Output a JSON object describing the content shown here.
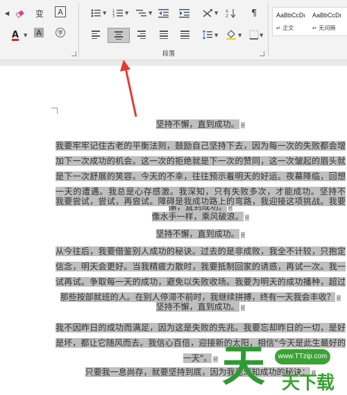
{
  "ribbon": {
    "font_tools": {
      "clear_format_icon": "eraser-icon",
      "phonetic_label": "变",
      "char_border_label": "A",
      "font_color_label": "A",
      "font_color": "#e02020",
      "char_shading_label": "A",
      "enclose_char_label": "字"
    },
    "paragraph": {
      "group_label": "段落"
    },
    "styles": [
      {
        "sample": "AaBbCcDı",
        "name": "↵ 正文"
      },
      {
        "sample": "AaBbCcDı",
        "name": "↵ 无间隔"
      }
    ]
  },
  "document": {
    "highlight_color": "#bfbfbf",
    "paragraphs": [
      "坚持不懈，直到成功。",
      "我要牢牢记住古老的平衡法则，鼓励自己坚持下去，因为每一次的失败都会增加下一次成功的机会。这一次的拒绝就是下一次的赞同，这一次皱起的眉头就是下一次舒展的笑容。今天的不幸，往往预示着明天的好运。夜幕降临，回想一天的遭遇。我总是心存感激。我深知，只有失败多次，才能成功。坚持不懈，直到成功。",
      "我要尝试，尝试，再尝试。障碍是我成功路上的弯路，我迎接这项挑战。我要像水手一样，乘风破浪。",
      "坚持不懈，直到成功。",
      "从今往后，我要借鉴别人成功的秘诀。过去的是非成败，我全不计较，只抱定信念，明天会更好。当我精疲力散时，我要抵制回家的诱惑，再试一次。我一试再试。争取每一天的成功，避免以失败收场。我要为明天的成功播种，超过那些按部就班的人。在别人停滞不前时，我继续拼搏，终有一天我会丰收？",
      "坚持不懈，直到成功。",
      "我不因昨日的成功而满足，因为这是失败的先兆。我要忘却昨日的一切，是好是坏，都让它随风而去。我信心百倍，迎接新的太阳，相信\"今天是此生最好的一天\"。",
      "只要我一息尚存，就要坚持到底，因为我已深知成功的秘诀："
    ],
    "paragraph_mark": "↵"
  },
  "watermark": {
    "big_char": "天",
    "url": "www.TTzip.com",
    "text": "天下载"
  }
}
